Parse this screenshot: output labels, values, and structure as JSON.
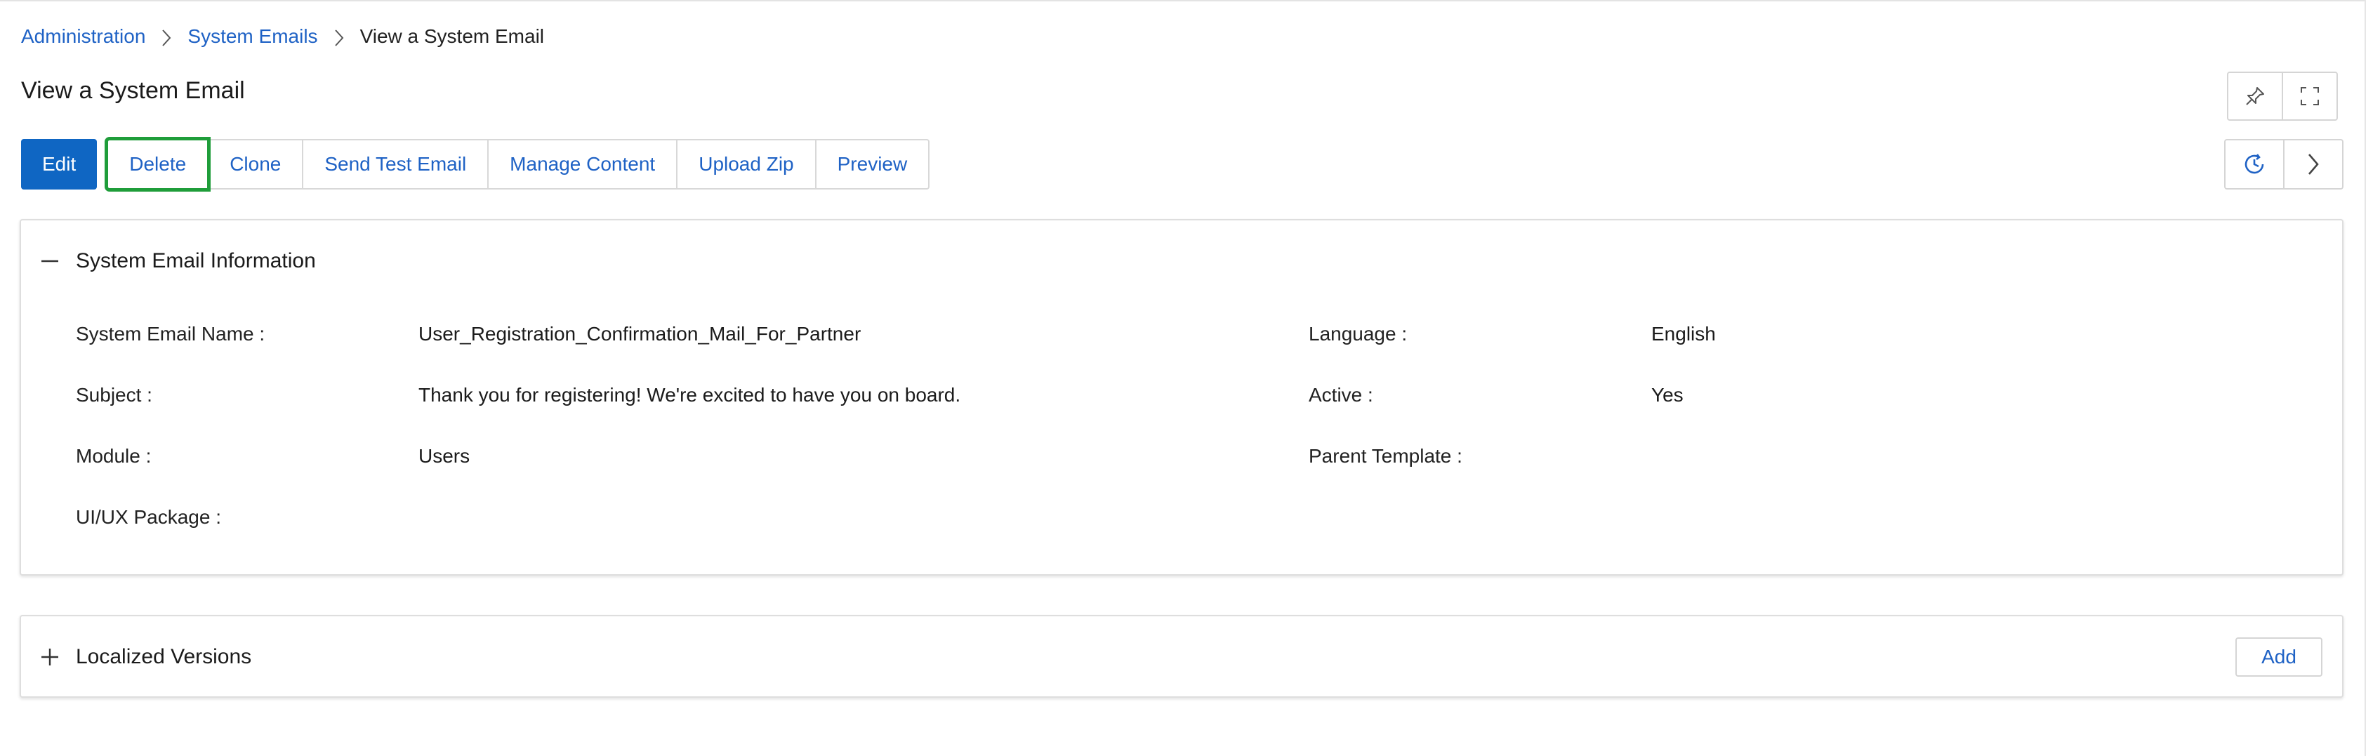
{
  "breadcrumb": {
    "items": [
      "Administration",
      "System Emails"
    ],
    "current": "View a System Email"
  },
  "page": {
    "title": "View a System Email"
  },
  "actions": {
    "edit": "Edit",
    "delete": "Delete",
    "clone": "Clone",
    "send_test_email": "Send Test Email",
    "manage_content": "Manage Content",
    "upload_zip": "Upload Zip",
    "preview": "Preview"
  },
  "icons": {
    "pin": "pin-icon",
    "fullscreen": "fullscreen-icon",
    "history": "history-icon",
    "next": "chevron-right-icon",
    "breadcrumb_separator": "chevron-right-icon",
    "collapse": "minus-icon",
    "expand": "plus-icon"
  },
  "info_section": {
    "title": "System Email Information",
    "fields": {
      "name_label": "System Email Name :",
      "name_value": "User_Registration_Confirmation_Mail_For_Partner",
      "language_label": "Language :",
      "language_value": "English",
      "subject_label": "Subject :",
      "subject_value": "Thank you for registering! We're excited to have you on board.",
      "active_label": "Active :",
      "active_value": "Yes",
      "module_label": "Module :",
      "module_value": "Users",
      "parent_label": "Parent Template :",
      "parent_value": "",
      "uiux_label": "UI/UX Package :",
      "uiux_value": ""
    }
  },
  "localized_section": {
    "title": "Localized Versions",
    "add_label": "Add"
  },
  "colors": {
    "primary": "#0f66c3",
    "link": "#1f62c5",
    "highlight": "#1f9d3a"
  }
}
